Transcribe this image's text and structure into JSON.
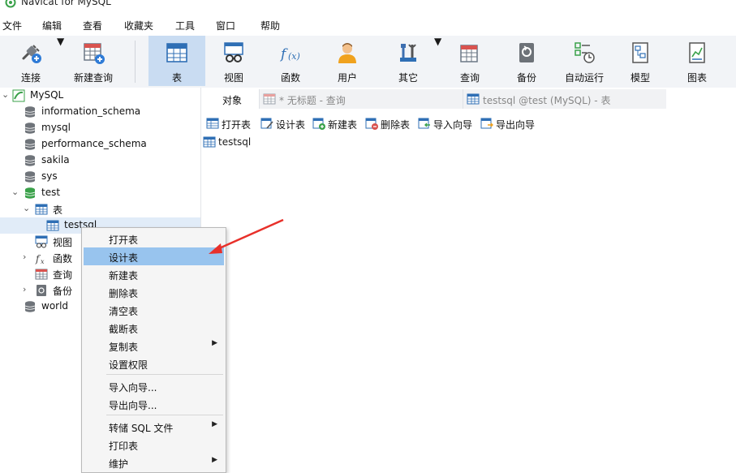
{
  "window": {
    "title": "Navicat for MySQL"
  },
  "menu": [
    "文件",
    "编辑",
    "查看",
    "收藏夹",
    "工具",
    "窗口",
    "帮助"
  ],
  "toolbar": {
    "connect": "连接",
    "new_query": "新建查询",
    "table": "表",
    "view": "视图",
    "function": "函数",
    "user": "用户",
    "other": "其它",
    "query": "查询",
    "backup": "备份",
    "automation": "自动运行",
    "model": "模型",
    "chart": "图表"
  },
  "tree": {
    "root": "MySQL",
    "databases": [
      "information_schema",
      "mysql",
      "performance_schema",
      "sakila",
      "sys"
    ],
    "test": "test",
    "tables_node": "表",
    "table_item": "testsql",
    "views_node": "视图",
    "functions_node": "函数",
    "queries_node": "查询",
    "backup_node": "备份",
    "world": "world"
  },
  "tabs": {
    "objects": "对象",
    "untitled_query": "* 无标题 - 查询",
    "table_tab": "testsql @test (MySQL) - 表"
  },
  "object_toolbar": {
    "open": "打开表",
    "design": "设计表",
    "new": "新建表",
    "delete": "删除表",
    "import": "导入向导",
    "export": "导出向导"
  },
  "object_list": [
    "testsql"
  ],
  "context_menu": {
    "open_table": "打开表",
    "design_table": "设计表",
    "new_table": "新建表",
    "delete_table": "删除表",
    "empty_table": "清空表",
    "truncate_table": "截断表",
    "copy_table": "复制表",
    "set_permissions": "设置权限",
    "import_wizard": "导入向导...",
    "export_wizard": "导出向导...",
    "dump_sql": "转储 SQL 文件",
    "print_table": "打印表",
    "maintain": "维护"
  },
  "colors": {
    "toolbar_bg": "#f2f4f7",
    "active_tool": "#c9dcf2",
    "menu_highlight": "#98c4ee",
    "annotation_arrow": "#e8302a"
  }
}
